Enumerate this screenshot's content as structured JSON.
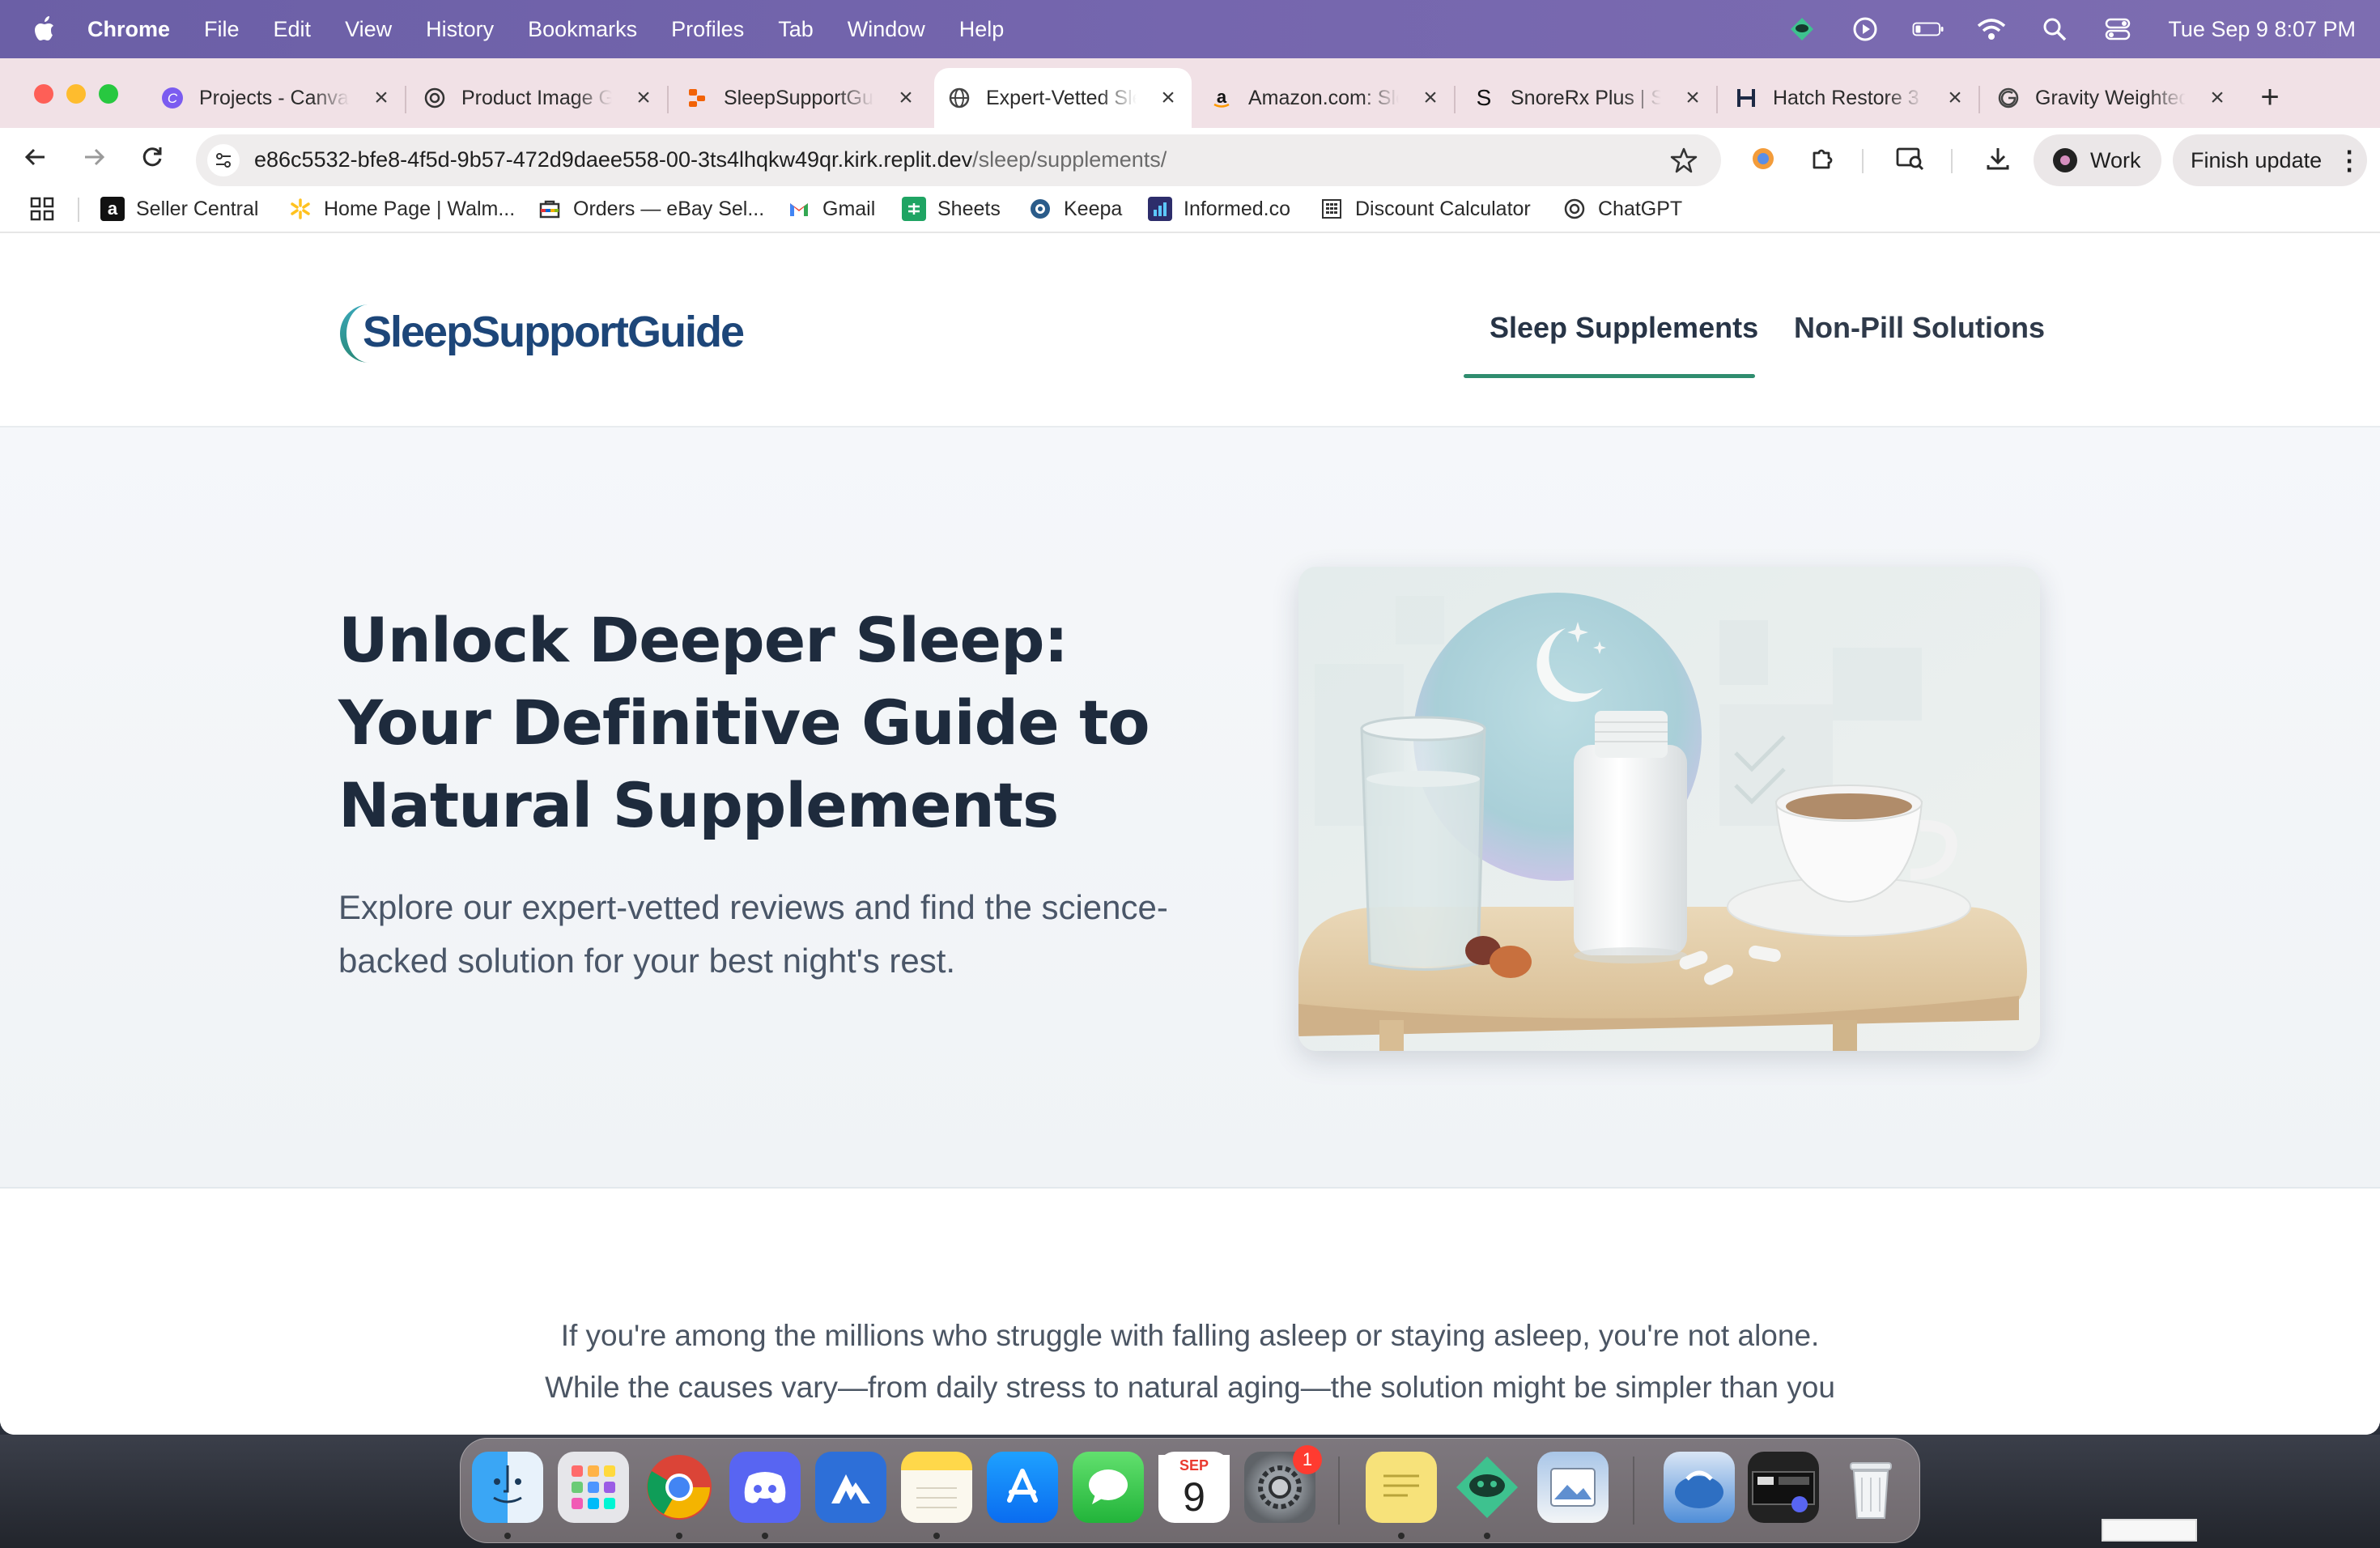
{
  "menubar": {
    "app_name": "Chrome",
    "items": [
      "File",
      "Edit",
      "View",
      "History",
      "Bookmarks",
      "Profiles",
      "Tab",
      "Window",
      "Help"
    ],
    "clock": "Tue Sep 9  8:07 PM"
  },
  "tabs": [
    {
      "title": "Projects - Canva",
      "icon": "canva-icon"
    },
    {
      "title": "Product Image Generator",
      "icon": "openai-icon"
    },
    {
      "title": "SleepSupportGuide",
      "icon": "replit-icon"
    },
    {
      "title": "Expert-Vetted Sleep Supplements",
      "icon": "globe-icon",
      "active": true
    },
    {
      "title": "Amazon.com: Sleep",
      "icon": "amazon-icon"
    },
    {
      "title": "SnoreRx Plus | Snoring",
      "icon": "snorerx-icon"
    },
    {
      "title": "Hatch Restore 3",
      "icon": "hatch-icon"
    },
    {
      "title": "Gravity Weighted Blanket",
      "icon": "gravity-icon"
    }
  ],
  "toolbar": {
    "url_host": "e86c5532-bfe8-4f5d-9b57-472d9daee558-00-3ts4lhqkw49qr.kirk.replit.dev",
    "url_path": "/sleep/supplements/",
    "profile_label": "Work",
    "update_label": "Finish update"
  },
  "bookmarks": [
    {
      "label": "Seller Central",
      "icon": "amazon-icon"
    },
    {
      "label": "Home Page | Walm...",
      "icon": "walmart-icon"
    },
    {
      "label": "Orders — eBay Sel...",
      "icon": "ebay-icon"
    },
    {
      "label": "Gmail",
      "icon": "gmail-icon"
    },
    {
      "label": "Sheets",
      "icon": "sheets-icon"
    },
    {
      "label": "Keepa",
      "icon": "keepa-icon"
    },
    {
      "label": "Informed.co",
      "icon": "informed-icon"
    },
    {
      "label": "Discount Calculator",
      "icon": "calculator-icon"
    },
    {
      "label": "ChatGPT",
      "icon": "openai-icon"
    }
  ],
  "site": {
    "logo_text": "SleepSupportGuide",
    "nav": [
      "Sleep Supplements",
      "Non-Pill Solutions"
    ],
    "hero_title": "Unlock Deeper Sleep: Your Definitive Guide to Natural Supplements",
    "hero_subtitle": "Explore our expert-vetted reviews and find the science-backed solution for your best night's rest.",
    "intro_line1": "If you're among the millions who struggle with falling asleep or staying asleep, you're not alone.",
    "intro_line2": "While the causes vary—from daily stress to natural aging—the solution might be simpler than you"
  },
  "dock": {
    "calendar_month": "SEP",
    "calendar_day": "9",
    "settings_badge": "1"
  },
  "colors": {
    "accent_green": "#2f8d6f",
    "logo_blue": "#1d4679",
    "menubar": "#7566ae",
    "tabstrip": "#f1e1e6"
  }
}
